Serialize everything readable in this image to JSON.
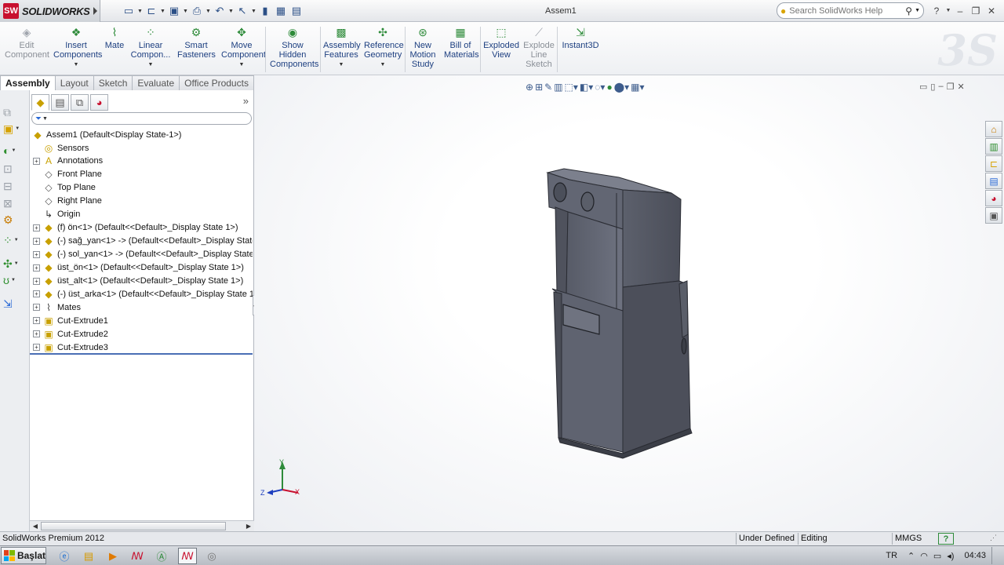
{
  "app": {
    "logo_text": "SOLIDWORKS",
    "logo_mark": "SW",
    "document_title": "Assem1"
  },
  "search": {
    "placeholder": "Search SolidWorks Help"
  },
  "quick_access": [
    {
      "name": "new-document-icon",
      "glyph": "▭"
    },
    {
      "name": "open-folder-icon",
      "glyph": "⊏"
    },
    {
      "name": "save-icon",
      "glyph": "▣"
    },
    {
      "name": "print-icon",
      "glyph": "⎙"
    },
    {
      "name": "undo-icon",
      "glyph": "↶"
    },
    {
      "name": "select-pointer-icon",
      "glyph": "↖"
    },
    {
      "name": "rebuild-icon",
      "glyph": "▮"
    },
    {
      "name": "file-properties-icon",
      "glyph": "▦"
    },
    {
      "name": "options-icon",
      "glyph": "▤"
    }
  ],
  "ribbon": {
    "commands": [
      {
        "id": "edit-component",
        "label": "Edit\nComponent",
        "enabled": false,
        "icon": "edit-component-icon",
        "glyph": "◈",
        "dropdown": false
      },
      {
        "id": "insert-components",
        "label": "Insert\nComponents",
        "enabled": true,
        "icon": "insert-components-icon",
        "glyph": "❖",
        "dropdown": true
      },
      {
        "id": "mate",
        "label": "Mate",
        "enabled": true,
        "icon": "mate-paperclip-icon",
        "glyph": "⌇",
        "dropdown": false
      },
      {
        "id": "linear-component-pattern",
        "label": "Linear\nCompon...",
        "enabled": true,
        "icon": "linear-pattern-icon",
        "glyph": "⁘",
        "dropdown": true
      },
      {
        "id": "smart-fasteners",
        "label": "Smart\nFasteners",
        "enabled": true,
        "icon": "smart-fasteners-icon",
        "glyph": "⚙",
        "dropdown": false
      },
      {
        "id": "move-component",
        "label": "Move\nComponent",
        "enabled": true,
        "icon": "move-component-icon",
        "glyph": "✥",
        "dropdown": true
      },
      {
        "id": "show-hidden-components",
        "label": "Show\nHidden\nComponents",
        "enabled": true,
        "icon": "show-hidden-icon",
        "glyph": "◉",
        "dropdown": false
      },
      {
        "id": "assembly-features",
        "label": "Assembly\nFeatures",
        "enabled": true,
        "icon": "assembly-features-icon",
        "glyph": "▩",
        "dropdown": true
      },
      {
        "id": "reference-geometry",
        "label": "Reference\nGeometry",
        "enabled": true,
        "icon": "reference-geometry-icon",
        "glyph": "✣",
        "dropdown": true
      },
      {
        "id": "new-motion-study",
        "label": "New\nMotion\nStudy",
        "enabled": true,
        "icon": "motion-study-icon",
        "glyph": "⊛",
        "dropdown": false
      },
      {
        "id": "bill-of-materials",
        "label": "Bill of\nMaterials",
        "enabled": true,
        "icon": "bill-of-materials-icon",
        "glyph": "▦",
        "dropdown": false
      },
      {
        "id": "exploded-view",
        "label": "Exploded\nView",
        "enabled": true,
        "icon": "exploded-view-icon",
        "glyph": "⬚",
        "dropdown": false
      },
      {
        "id": "explode-line-sketch",
        "label": "Explode\nLine\nSketch",
        "enabled": false,
        "icon": "explode-line-sketch-icon",
        "glyph": "⟋",
        "dropdown": false
      },
      {
        "id": "instant3d",
        "label": "Instant3D",
        "enabled": true,
        "icon": "instant3d-icon",
        "glyph": "⇲",
        "dropdown": false
      }
    ]
  },
  "tabs": [
    {
      "label": "Assembly",
      "active": true
    },
    {
      "label": "Layout",
      "active": false
    },
    {
      "label": "Sketch",
      "active": false
    },
    {
      "label": "Evaluate",
      "active": false
    },
    {
      "label": "Office Products",
      "active": false
    }
  ],
  "feature_tree": {
    "root": "Assem1  (Default<Display State-1>)",
    "items": [
      {
        "label": "Sensors",
        "icon": "sensors-folder-icon",
        "glyph": "◎",
        "expandable": false
      },
      {
        "label": "Annotations",
        "icon": "annotations-icon",
        "glyph": "A",
        "expandable": true
      },
      {
        "label": "Front Plane",
        "icon": "plane-icon",
        "glyph": "◇",
        "expandable": false
      },
      {
        "label": "Top Plane",
        "icon": "plane-icon",
        "glyph": "◇",
        "expandable": false
      },
      {
        "label": "Right Plane",
        "icon": "plane-icon",
        "glyph": "◇",
        "expandable": false
      },
      {
        "label": "Origin",
        "icon": "origin-icon",
        "glyph": "↳",
        "expandable": false
      },
      {
        "label": "(f) ön<1> (Default<<Default>_Display State 1>)",
        "icon": "part-component-icon",
        "glyph": "◆",
        "expandable": true
      },
      {
        "label": "(-) sağ_yan<1> -> (Default<<Default>_Display State",
        "icon": "part-component-icon",
        "glyph": "◆",
        "expandable": true
      },
      {
        "label": "(-) sol_yan<1> -> (Default<<Default>_Display State",
        "icon": "part-component-icon",
        "glyph": "◆",
        "expandable": true
      },
      {
        "label": "üst_ön<1> (Default<<Default>_Display State 1>)",
        "icon": "part-component-icon",
        "glyph": "◆",
        "expandable": true
      },
      {
        "label": "üst_alt<1> (Default<<Default>_Display State 1>)",
        "icon": "part-component-icon",
        "glyph": "◆",
        "expandable": true
      },
      {
        "label": "(-) üst_arka<1> (Default<<Default>_Display State 1",
        "icon": "part-component-icon",
        "glyph": "◆",
        "expandable": true
      },
      {
        "label": "Mates",
        "icon": "mates-icon",
        "glyph": "⌇",
        "expandable": true
      },
      {
        "label": "Cut-Extrude1",
        "icon": "cut-extrude-icon",
        "glyph": "▣",
        "expandable": true
      },
      {
        "label": "Cut-Extrude2",
        "icon": "cut-extrude-icon",
        "glyph": "▣",
        "expandable": true
      },
      {
        "label": "Cut-Extrude3",
        "icon": "cut-extrude-icon",
        "glyph": "▣",
        "expandable": true
      }
    ]
  },
  "triad": {
    "x": "X",
    "y": "Y",
    "z": "Z"
  },
  "status": {
    "product": "SolidWorks Premium 2012",
    "state": "Under Defined",
    "mode": "Editing Assembly",
    "units": "MMGS",
    "help_badge": "?"
  },
  "taskbar": {
    "start_label": "Başlat",
    "language": "TR",
    "clock": "04:43"
  },
  "colors": {
    "model_face": "#6b6f7c",
    "model_dark": "#4a4d57",
    "accent_red": "#c8102e",
    "tree_underline": "#4a6fb5"
  }
}
